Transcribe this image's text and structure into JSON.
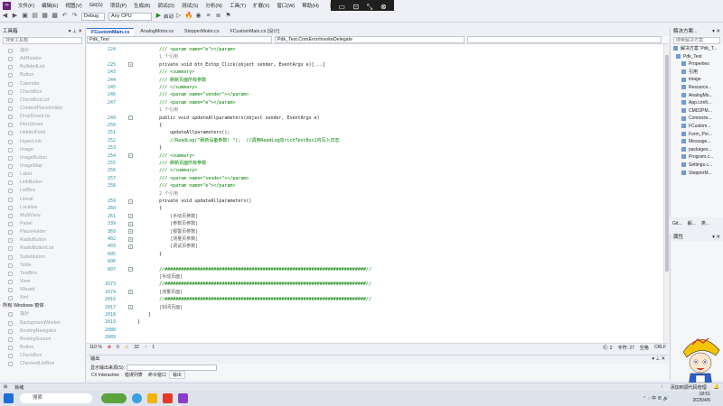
{
  "menu": {
    "items": [
      "文件(F)",
      "编辑(E)",
      "视图(V)",
      "Git(G)",
      "项目(P)",
      "生成(B)",
      "调试(D)",
      "测试(S)",
      "分析(N)",
      "工具(T)",
      "扩展(X)",
      "窗口(W)",
      "帮助(H)"
    ],
    "search_label": "搜索"
  },
  "toolbar": {
    "config": "Debug",
    "platform": "Any CPU",
    "start_label": "启动"
  },
  "toolbox": {
    "title": "工具箱",
    "search_placeholder": "搜索工具箱",
    "items": [
      "指针",
      "AdRotator",
      "BulletedList",
      "Button",
      "Calendar",
      "CheckBox",
      "CheckBoxList",
      "ContentPlaceHolder",
      "DropDownList",
      "FileUpload",
      "HiddenField",
      "HyperLink",
      "Image",
      "ImageButton",
      "ImageMap",
      "Label",
      "LinkButton",
      "ListBox",
      "Literal",
      "Localize",
      "MultiView",
      "Panel",
      "PlaceHolder",
      "RadioButton",
      "RadioButtonList",
      "Substitution",
      "Table",
      "TextBox",
      "View",
      "Wizard",
      "Xml"
    ],
    "section2": "所有 Windows 窗体",
    "items2": [
      "指针",
      "BackgroundWorker",
      "BindingNavigator",
      "BindingSource",
      "Button",
      "CheckBox",
      "CheckedListBox"
    ]
  },
  "tabs": [
    "FCustomMain.cs",
    "AnalogMotor.cs",
    "StepperMotor.cs",
    "FCustomMain.cs [设计]"
  ],
  "nav": {
    "project": "Pdk_Test",
    "class": "Pdk_Test.ComErrorInvokeDelegate",
    "member": ""
  },
  "code": {
    "lines": [
      {
        "n": "224",
        "t": "        /// <param name=\"e\"></param>",
        "c": "cm"
      },
      {
        "n": "",
        "t": "        1 个引用",
        "c": "gr"
      },
      {
        "n": "225",
        "t": "        private void btn_Estop_Click(object sender, EventArgs e)[...]",
        "c": "code",
        "fold": "+"
      },
      {
        "n": "243",
        "t": "        /// <summary>",
        "c": "cm"
      },
      {
        "n": "244",
        "t": "        /// 刷新页面所有参数",
        "c": "cm"
      },
      {
        "n": "245",
        "t": "        /// </summary>",
        "c": "cm"
      },
      {
        "n": "246",
        "t": "        /// <param name=\"sender\"></param>",
        "c": "cm"
      },
      {
        "n": "247",
        "t": "        /// <param name=\"e\"></param>",
        "c": "cm"
      },
      {
        "n": "",
        "t": "        1 个引用",
        "c": "gr"
      },
      {
        "n": "249",
        "t": "        public void updateAllparameters(object sender, EventArgs e)",
        "c": "code",
        "fold": "-"
      },
      {
        "n": "250",
        "t": "        {",
        "c": "code"
      },
      {
        "n": "251",
        "t": "            updateAllparameters();",
        "c": "code"
      },
      {
        "n": "252",
        "t": "            //ReadLog(\"刷新设备参数! \");  //调用ReadLog向richTextBox1内写入日志",
        "c": "cm"
      },
      {
        "n": "253",
        "t": "        }",
        "c": "code"
      },
      {
        "n": "254",
        "t": "        /// <summary>",
        "c": "cm",
        "fold": "-"
      },
      {
        "n": "255",
        "t": "        /// 刷新页面所有参数",
        "c": "cm"
      },
      {
        "n": "256",
        "t": "        /// </summary>",
        "c": "cm"
      },
      {
        "n": "257",
        "t": "        /// <param name=\"sender\"></param>",
        "c": "cm"
      },
      {
        "n": "258",
        "t": "        /// <param name=\"e\"></param>",
        "c": "cm"
      },
      {
        "n": "",
        "t": "        2 个引用",
        "c": "gr"
      },
      {
        "n": "259",
        "t": "        private void updateAllparameters()",
        "c": "code",
        "fold": "-"
      },
      {
        "n": "260",
        "t": "        {",
        "c": "code"
      },
      {
        "n": "261",
        "t": "            [手动页参数]",
        "c": "box",
        "fold": "+"
      },
      {
        "n": "339",
        "t": "            [参数页参数]",
        "c": "box",
        "fold": "+"
      },
      {
        "n": "369",
        "t": "            [报警页参数]",
        "c": "box",
        "fold": "+"
      },
      {
        "n": "402",
        "t": "            [测量页参数]",
        "c": "box",
        "fold": "+"
      },
      {
        "n": "403",
        "t": "            [调试页参数]",
        "c": "box",
        "fold": "+"
      },
      {
        "n": "605",
        "t": "        }",
        "c": "code"
      },
      {
        "n": "606",
        "t": "",
        "c": "code"
      },
      {
        "n": "607",
        "t": "        //##########################################################################//",
        "c": "cm",
        "fold": "-"
      },
      {
        "n": "",
        "t": "        [手动页面]",
        "c": "box"
      },
      {
        "n": "1673",
        "t": "        //##########################################################################//",
        "c": "cm"
      },
      {
        "n": "1674",
        "t": "        [测量页面]",
        "c": "box",
        "fold": "+"
      },
      {
        "n": "2016",
        "t": "        //##########################################################################//",
        "c": "cm"
      },
      {
        "n": "2017",
        "t": "        [封闭页面]",
        "c": "box",
        "fold": "+"
      },
      {
        "n": "2018",
        "t": "    }",
        "c": "code"
      },
      {
        "n": "2019",
        "t": "}",
        "c": "code"
      },
      {
        "n": "2088",
        "t": "",
        "c": "code"
      },
      {
        "n": "2089",
        "t": "",
        "c": "code"
      }
    ]
  },
  "editor_status": {
    "zoom": "110 %",
    "errors": "0",
    "warnings": "32",
    "up": "1",
    "line": "行: 2",
    "col": "字符: 27",
    "space": "空格",
    "eol": "CRLF"
  },
  "output": {
    "title": "输出",
    "source_label": "显示输出来源(S):",
    "tabs": [
      "C# Interactive",
      "错误列表",
      "命令窗口",
      "输出"
    ]
  },
  "solution": {
    "title": "解决方案...",
    "search": "搜索解决方案",
    "items": [
      "解决方案 'Pdk_T...",
      "Pdk_Test",
      "Properties",
      "引用",
      "image",
      "Resource...",
      "AnalogMo...",
      "App.confi...",
      "CMD2PM...",
      "Connecte...",
      "FCustom...",
      "Form_Poi...",
      "Message...",
      "packages...",
      "Program.c...",
      "Settings.c...",
      "StepperM..."
    ]
  },
  "se_tabs": [
    "Git...",
    "解...",
    "类..."
  ],
  "properties_title": "属性",
  "statusbar": {
    "left": "就绪",
    "right": "添加到源代码管理"
  },
  "taskbar": {
    "search": "搜索",
    "time": "18:51",
    "date": "2025/4/5"
  }
}
